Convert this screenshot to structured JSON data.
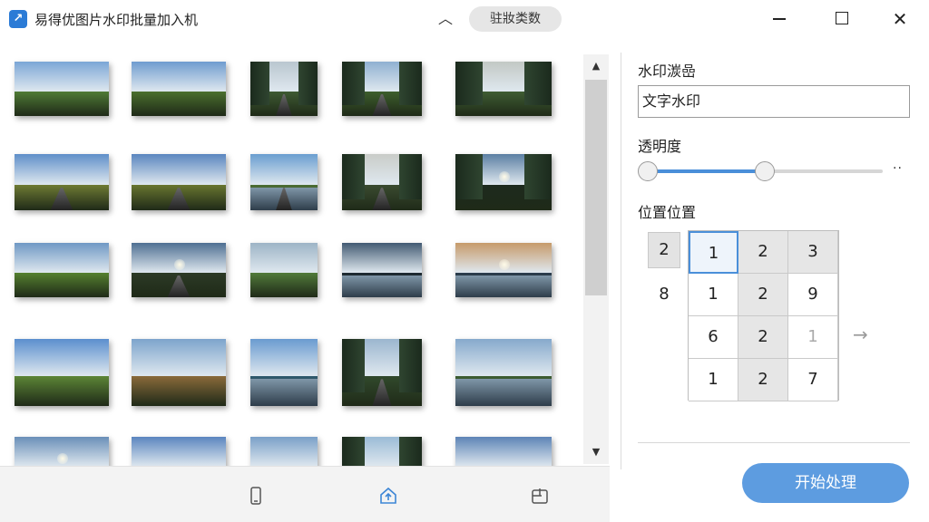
{
  "window": {
    "title": "易得优图片水印批量加入机",
    "params_button": "驻妝类数",
    "collapse_icon": "chevron-up-icon",
    "minimize_icon": "minimize-icon",
    "maximize_icon": "maximize-icon",
    "close_icon": "close-icon"
  },
  "gallery": {
    "thumbnails": [
      {
        "scene": "meadow",
        "sky": "#7ba6d6",
        "land": "#4f7a35"
      },
      {
        "scene": "meadow",
        "sky": "#6f9ccf",
        "land": "#4b6f2e"
      },
      {
        "scene": "forest-road",
        "sky": "#b9c6cf",
        "land": "#3e5a33"
      },
      {
        "scene": "forest-road",
        "sky": "#8fb0d1",
        "land": "#3d5e2c"
      },
      {
        "scene": "forest",
        "sky": "#c2c8c4",
        "land": "#3f5d33"
      },
      {
        "scene": "field-path",
        "sky": "#5f8fc9",
        "land": "#6e7a33"
      },
      {
        "scene": "field-path",
        "sky": "#5a86bf",
        "land": "#68752f"
      },
      {
        "scene": "road-lake",
        "sky": "#6a9ed0",
        "land": "#4c6e34"
      },
      {
        "scene": "forest-road",
        "sky": "#c9ccc8",
        "land": "#3a4b30"
      },
      {
        "scene": "forest-sunset",
        "sky": "#5b7fa3",
        "land": "#1d2a1e"
      },
      {
        "scene": "meadow",
        "sky": "#6f98c4",
        "land": "#55802f"
      },
      {
        "scene": "road-sun",
        "sky": "#4e6f92",
        "land": "#2c3a26"
      },
      {
        "scene": "hills",
        "sky": "#9db4c6",
        "land": "#517a3a"
      },
      {
        "scene": "lake",
        "sky": "#425a72",
        "land": "#1e2a33"
      },
      {
        "scene": "lake-sunset",
        "sky": "#c69a6a",
        "land": "#2c3d4e"
      },
      {
        "scene": "valley",
        "sky": "#5b8fce",
        "land": "#5c8536"
      },
      {
        "scene": "autumn",
        "sky": "#7da4cc",
        "land": "#8a6a3a"
      },
      {
        "scene": "lake",
        "sky": "#6a9bd0",
        "land": "#2f5a6e"
      },
      {
        "scene": "forest-road",
        "sky": "#9bb6cf",
        "land": "#31492c"
      },
      {
        "scene": "lake-forest",
        "sky": "#86a9cc",
        "land": "#3e5e32"
      },
      {
        "scene": "sun-sky",
        "sky": "#6a8fb8",
        "land": "#4d6a35"
      },
      {
        "scene": "sky",
        "sky": "#5b86bf",
        "land": "#4e6a33"
      },
      {
        "scene": "sky",
        "sky": "#7aa0c8",
        "land": "#4a6c35"
      },
      {
        "scene": "forest",
        "sky": "#9bbbd6",
        "land": "#2f4a2a"
      },
      {
        "scene": "mountains",
        "sky": "#5d84b6",
        "land": "#3c5a40"
      }
    ]
  },
  "toolbar": {
    "icons": [
      "phone-icon",
      "home-upload-icon",
      "folder-icon"
    ]
  },
  "panel": {
    "watermark_label": "水印湠嵒",
    "watermark_value": "文字水印",
    "opacity_label": "透明度",
    "opacity_low": 0.0,
    "opacity_high": 0.5,
    "slider_more": "··",
    "position_label": "位置位置",
    "side_values": [
      "2",
      "8"
    ],
    "grid": [
      [
        "1",
        "2",
        "3"
      ],
      [
        "1",
        "2",
        "9"
      ],
      [
        "6",
        "2",
        "1"
      ],
      [
        "1",
        "2",
        "7"
      ]
    ],
    "selected_cell": "0-0",
    "arrow_icon": "arrow-right-icon",
    "start_button": "开始处理"
  }
}
